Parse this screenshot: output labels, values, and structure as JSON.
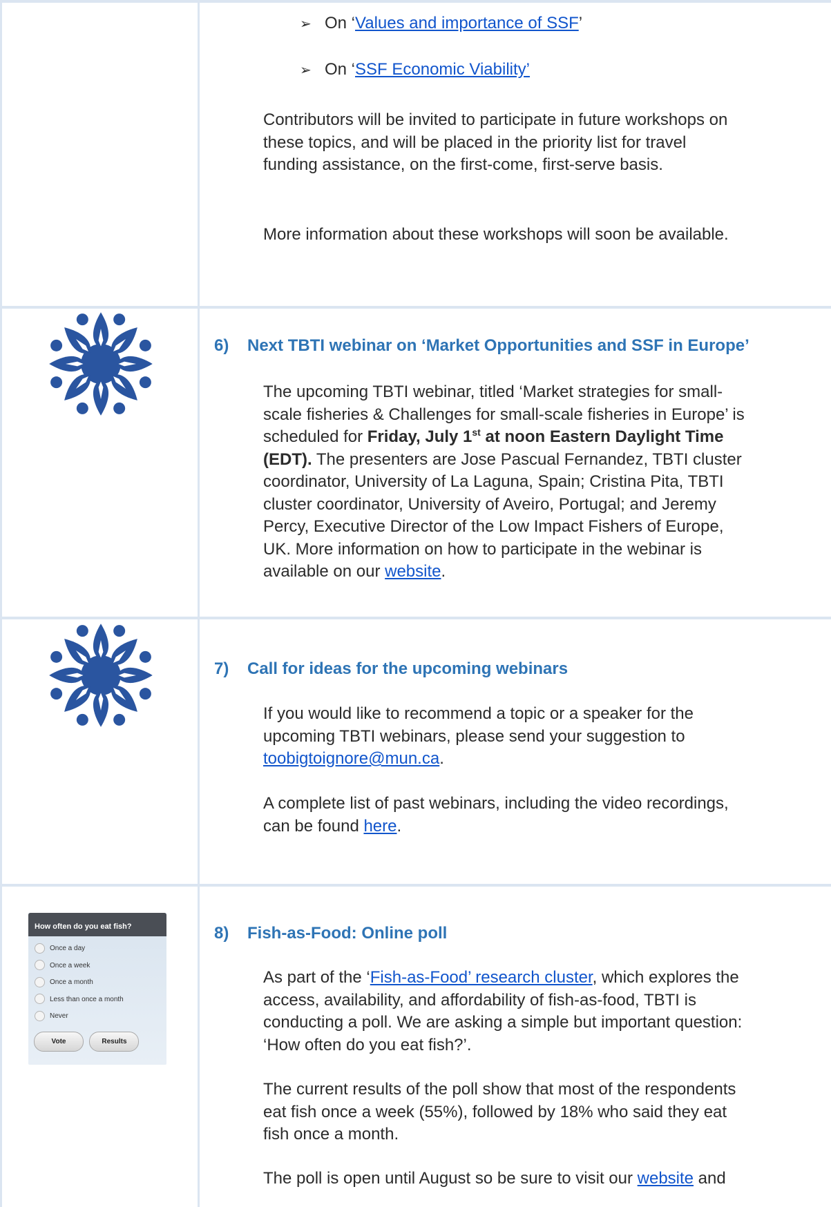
{
  "top_section": {
    "bullets": [
      {
        "prefix": "On ‘",
        "link": "Values and importance of SSF",
        "suffix": "’"
      },
      {
        "prefix": "On ‘",
        "link": "SSF Economic Viability’",
        "suffix": ""
      }
    ],
    "para1": "Contributors will be invited to participate in future workshops on these topics, and will be placed in the priority list for travel funding assistance, on the first-come, first-serve basis.",
    "para2": "More information about these workshops will soon be available."
  },
  "section6": {
    "number": "6)",
    "title": "Next TBTI webinar on ‘Market Opportunities and SSF in Europe’",
    "text_a": "The upcoming TBTI webinar, titled ‘Market strategies for small-scale fisheries & Challenges for small-scale fisheries in Europe’ is scheduled for ",
    "bold_a": "Friday, July 1",
    "bold_sup": "st",
    "bold_b": " at noon Eastern Daylight Time (EDT).",
    "text_b": " The presenters are Jose Pascual Fernandez, TBTI cluster coordinator, University of La Laguna, Spain; Cristina Pita, TBTI cluster coordinator, University of Aveiro, Portugal; and Jeremy Percy, Executive Director of the Low Impact Fishers of Europe, UK. More information on how to participate in the webinar is available on our ",
    "link": "website",
    "end": "."
  },
  "section7": {
    "number": "7)",
    "title": "Call for ideas for the upcoming webinars",
    "p1_text": "If you would like to recommend a topic or a speaker for the upcoming TBTI webinars, please send your suggestion to ",
    "p1_link": "toobigtoignore@mun.ca",
    "p1_end": ".",
    "p2_text": "A complete list of past webinars, including the video recordings, can be found ",
    "p2_link": "here",
    "p2_end": "."
  },
  "section8": {
    "number": "8)",
    "title": "Fish-as-Food: Online poll",
    "p1_a": "As part of the ‘",
    "p1_link": "Fish-as-Food’ research cluster",
    "p1_b": ", which explores the access, availability, and affordability of fish-as-food, TBTI is conducting a poll. We are asking a simple but important question: ‘How often do you eat fish?’.",
    "p2": "The current results of the poll show that most of the respondents eat fish once a week (55%), followed by 18% who said they eat fish once a month.",
    "p3_a": "The poll is open until August so be sure to visit our ",
    "p3_link": "website",
    "p3_b": " and"
  },
  "poll": {
    "question": "How often do you eat fish?",
    "options": [
      "Once a day",
      "Once a week",
      "Once a month",
      "Less than once a month",
      "Never"
    ],
    "vote": "Vote",
    "results": "Results"
  },
  "colors": {
    "heading": "#2e74b5",
    "link": "#1155cc",
    "logo": "#2a55a0",
    "border": "#dbe5f1"
  }
}
